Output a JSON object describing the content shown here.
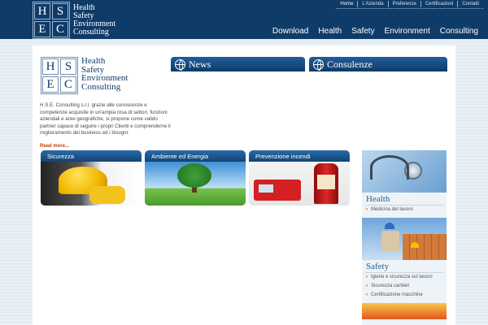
{
  "brand": {
    "letters": [
      "H",
      "S",
      "E",
      "C"
    ],
    "lines": [
      "Health",
      "Safety",
      "Environment",
      "Consulting"
    ]
  },
  "top_links": [
    "Home",
    "L'Azienda",
    "Preferenze",
    "Certificazioni",
    "Contatti"
  ],
  "main_nav": [
    "Download",
    "Health",
    "Safety",
    "Environment",
    "Consulting"
  ],
  "intro": {
    "text": "H.S.E. Consulting s.r.l. grazie alle conoscenze e competenze acquisite in un'ampia rosa di settori, funzioni aziendali e aree geografiche, si propone come valido partner capace di seguire i propri Clienti e comprenderne il miglioramento del business ed i bisogni.",
    "read_more": "Read more..."
  },
  "panels": {
    "news": "News",
    "consulenze": "Consulenze"
  },
  "tiles": [
    "Sicurezza",
    "Ambiente ed Energia",
    "Prevenzione incendi"
  ],
  "sidebar": {
    "health": {
      "title": "Health",
      "links": [
        "Medicina del lavoro"
      ]
    },
    "safety": {
      "title": "Safety",
      "links": [
        "Igiene e sicurezza sul lavoro",
        "Sicurezza cantieri",
        "Certificazione macchine"
      ]
    }
  },
  "colors": {
    "navy": "#0f3b68",
    "accent": "#c04000"
  }
}
